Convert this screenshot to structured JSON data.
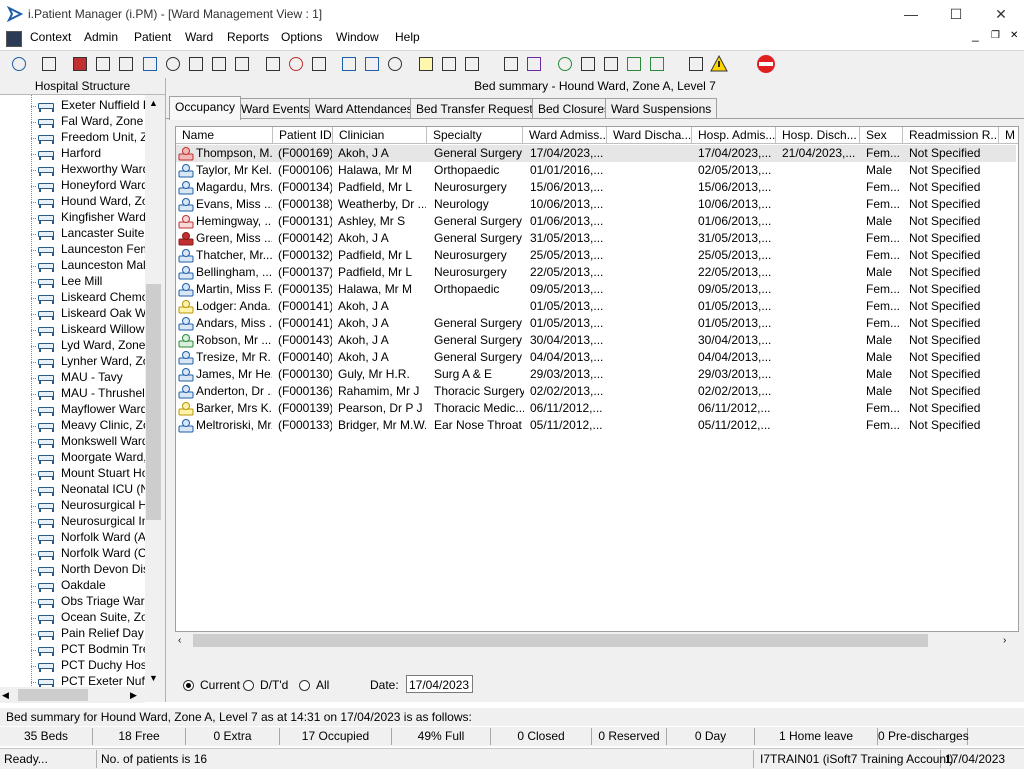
{
  "window": {
    "title": "i.Patient Manager (i.PM) - [Ward Management View : 1]",
    "minimize": "—",
    "maximize": "☐",
    "close": "✕",
    "mdi_minimize": "_",
    "mdi_restore": "❐",
    "mdi_close": "✕"
  },
  "menu": [
    "Context",
    "Admin",
    "Patient",
    "Ward",
    "Reports",
    "Options",
    "Window",
    "Help"
  ],
  "left_panel": {
    "header": "Hospital Structure",
    "items": [
      "Exeter Nuffield H",
      "Fal Ward, Zone E",
      "Freedom Unit, Zo",
      "Harford",
      "Hexworthy Ward,",
      "Honeyford Ward,",
      "Hound Ward, Zor",
      "Kingfisher Ward",
      "Lancaster Suite, Z",
      "Launceston Fema",
      "Launceston Male",
      "Lee Mill",
      "Liskeard Chemo D",
      "Liskeard Oak Wa",
      "Liskeard Willow V",
      "Lyd Ward, Zone I",
      "Lynher Ward, Zor",
      "MAU - Tavy",
      "MAU - Thrushel",
      "Mayflower Ward,",
      "Meavy Clinic, Zor",
      "Monkswell Ward,",
      "Moorgate Ward, Z",
      "Mount Stuart Hos",
      "Neonatal ICU (NN",
      "Neurosurgical Hig",
      "Neurosurgical Inte",
      "Norfolk Ward (Ad",
      "Norfolk Ward (Co",
      "North Devon Dist",
      "Oakdale",
      "Obs Triage Ward",
      "Ocean Suite, Zor",
      "Pain Relief Day C",
      "PCT Bodmin Trea",
      "PCT Duchy Hosp",
      "PCT Exeter Nuffie"
    ]
  },
  "main": {
    "bed_summary_title": "Bed summary - Hound Ward, Zone A, Level 7",
    "tabs": [
      "Occupancy",
      "Ward Events",
      "Ward Attendances",
      "Bed Transfer Requests",
      "Bed Closures",
      "Ward Suspensions"
    ],
    "active_tab": "Occupancy",
    "columns": [
      "Name",
      "Patient ID",
      "Clinician",
      "Specialty",
      "Ward Admiss...",
      "Ward Discha...",
      "Hosp. Admis...",
      "Hosp. Disch...",
      "Sex",
      "Readmission R...",
      "M"
    ],
    "rows": [
      {
        "icon": "red-case",
        "name": "Thompson, M...",
        "id": "(F000169)",
        "clinician": "Akoh, J A",
        "specialty": "General Surgery",
        "ward_adm": "17/04/2023,...",
        "ward_dis": "",
        "hosp_adm": "17/04/2023,...",
        "hosp_dis": "21/04/2023,...",
        "sex": "Fem...",
        "readm": "Not Specified"
      },
      {
        "icon": "patient",
        "name": "Taylor, Mr Kel...",
        "id": "(F000106)",
        "clinician": "Halawa, Mr M",
        "specialty": "Orthopaedic",
        "ward_adm": "01/01/2016,...",
        "ward_dis": "",
        "hosp_adm": "02/05/2013,...",
        "hosp_dis": "",
        "sex": "Male",
        "readm": "Not Specified"
      },
      {
        "icon": "patient",
        "name": "Magardu, Mrs...",
        "id": "(F000134)",
        "clinician": "Padfield, Mr L",
        "specialty": "Neurosurgery",
        "ward_adm": "15/06/2013,...",
        "ward_dis": "",
        "hosp_adm": "15/06/2013,...",
        "hosp_dis": "",
        "sex": "Fem...",
        "readm": "Not Specified"
      },
      {
        "icon": "patient",
        "name": "Evans, Miss ...",
        "id": "(F000138)",
        "clinician": "Weatherby, Dr ...",
        "specialty": "Neurology",
        "ward_adm": "10/06/2013,...",
        "ward_dis": "",
        "hosp_adm": "10/06/2013,...",
        "hosp_dis": "",
        "sex": "Fem...",
        "readm": "Not Specified"
      },
      {
        "icon": "patient-red",
        "name": "Hemingway, ...",
        "id": "(F000131)",
        "clinician": "Ashley, Mr S",
        "specialty": "General Surgery",
        "ward_adm": "01/06/2013,...",
        "ward_dis": "",
        "hosp_adm": "01/06/2013,...",
        "hosp_dis": "",
        "sex": "Male",
        "readm": "Not Specified"
      },
      {
        "icon": "red-box",
        "name": "Green, Miss ...",
        "id": "(F000142)",
        "clinician": "Akoh, J A",
        "specialty": "General Surgery",
        "ward_adm": "31/05/2013,...",
        "ward_dis": "",
        "hosp_adm": "31/05/2013,...",
        "hosp_dis": "",
        "sex": "Fem...",
        "readm": "Not Specified"
      },
      {
        "icon": "patient",
        "name": "Thatcher, Mr...",
        "id": "(F000132)",
        "clinician": "Padfield, Mr L",
        "specialty": "Neurosurgery",
        "ward_adm": "25/05/2013,...",
        "ward_dis": "",
        "hosp_adm": "25/05/2013,...",
        "hosp_dis": "",
        "sex": "Fem...",
        "readm": "Not Specified"
      },
      {
        "icon": "patient",
        "name": "Bellingham, ...",
        "id": "(F000137)",
        "clinician": "Padfield, Mr L",
        "specialty": "Neurosurgery",
        "ward_adm": "22/05/2013,...",
        "ward_dis": "",
        "hosp_adm": "22/05/2013,...",
        "hosp_dis": "",
        "sex": "Male",
        "readm": "Not Specified"
      },
      {
        "icon": "patient",
        "name": "Martin, Miss F...",
        "id": "(F000135)",
        "clinician": "Halawa, Mr M",
        "specialty": "Orthopaedic",
        "ward_adm": "09/05/2013,...",
        "ward_dis": "",
        "hosp_adm": "09/05/2013,...",
        "hosp_dis": "",
        "sex": "Fem...",
        "readm": "Not Specified"
      },
      {
        "icon": "patient-yellow",
        "name": "Lodger: Anda...",
        "id": "(F000141)",
        "clinician": "Akoh, J A",
        "specialty": "",
        "ward_adm": "01/05/2013,...",
        "ward_dis": "",
        "hosp_adm": "01/05/2013,...",
        "hosp_dis": "",
        "sex": "Fem...",
        "readm": "Not Specified"
      },
      {
        "icon": "patient",
        "name": "Andars, Miss ...",
        "id": "(F000141)",
        "clinician": "Akoh, J A",
        "specialty": "General Surgery",
        "ward_adm": "01/05/2013,...",
        "ward_dis": "",
        "hosp_adm": "01/05/2013,...",
        "hosp_dis": "",
        "sex": "Fem...",
        "readm": "Not Specified"
      },
      {
        "icon": "patient-green",
        "name": "Robson, Mr ...",
        "id": "(F000143)",
        "clinician": "Akoh, J A",
        "specialty": "General Surgery",
        "ward_adm": "30/04/2013,...",
        "ward_dis": "",
        "hosp_adm": "30/04/2013,...",
        "hosp_dis": "",
        "sex": "Male",
        "readm": "Not Specified"
      },
      {
        "icon": "patient",
        "name": "Tresize, Mr R...",
        "id": "(F000140)",
        "clinician": "Akoh, J A",
        "specialty": "General Surgery",
        "ward_adm": "04/04/2013,...",
        "ward_dis": "",
        "hosp_adm": "04/04/2013,...",
        "hosp_dis": "",
        "sex": "Male",
        "readm": "Not Specified"
      },
      {
        "icon": "patient",
        "name": "James, Mr He...",
        "id": "(F000130)",
        "clinician": "Guly, Mr H.R.",
        "specialty": "Surg A & E",
        "ward_adm": "29/03/2013,...",
        "ward_dis": "",
        "hosp_adm": "29/03/2013,...",
        "hosp_dis": "",
        "sex": "Male",
        "readm": "Not Specified"
      },
      {
        "icon": "patient",
        "name": "Anderton, Dr ...",
        "id": "(F000136)",
        "clinician": "Rahamim, Mr J",
        "specialty": "Thoracic Surgery",
        "ward_adm": "02/02/2013,...",
        "ward_dis": "",
        "hosp_adm": "02/02/2013,...",
        "hosp_dis": "",
        "sex": "Male",
        "readm": "Not Specified"
      },
      {
        "icon": "patient-yellow",
        "name": "Barker, Mrs K...",
        "id": "(F000139)",
        "clinician": "Pearson, Dr P J",
        "specialty": "Thoracic Medic...",
        "ward_adm": "06/11/2012,...",
        "ward_dis": "",
        "hosp_adm": "06/11/2012,...",
        "hosp_dis": "",
        "sex": "Fem...",
        "readm": "Not Specified"
      },
      {
        "icon": "patient",
        "name": "Meltroriski, Mr...",
        "id": "(F000133)",
        "clinician": "Bridger, Mr M.W.",
        "specialty": "Ear Nose Throat",
        "ward_adm": "05/11/2012,...",
        "ward_dis": "",
        "hosp_adm": "05/11/2012,...",
        "hosp_dis": "",
        "sex": "Fem...",
        "readm": "Not Specified"
      }
    ],
    "filter": {
      "options": [
        "Current",
        "D/T'd",
        "All"
      ],
      "selected": "Current",
      "date_label": "Date:",
      "date_value": "17/04/2023"
    }
  },
  "summary_line": "Bed summary for Hound Ward, Zone A, Level 7 as at 14:31 on 17/04/2023 is as follows:",
  "counts": [
    "35 Beds",
    "18 Free",
    "0 Extra",
    "17 Occupied",
    "49% Full",
    "0 Closed",
    "0 Reserved",
    "0 Day",
    "1 Home leave",
    "0 Pre-discharges"
  ],
  "status": {
    "ready": "Ready...",
    "patients": "No. of patients is 16",
    "user": "I7TRAIN01 (iSoft7 Training Account)",
    "date": "17/04/2023"
  },
  "colors": {
    "accent": "#1f5ea8",
    "exit": "#e02020",
    "selection": "#e6e6e6"
  }
}
